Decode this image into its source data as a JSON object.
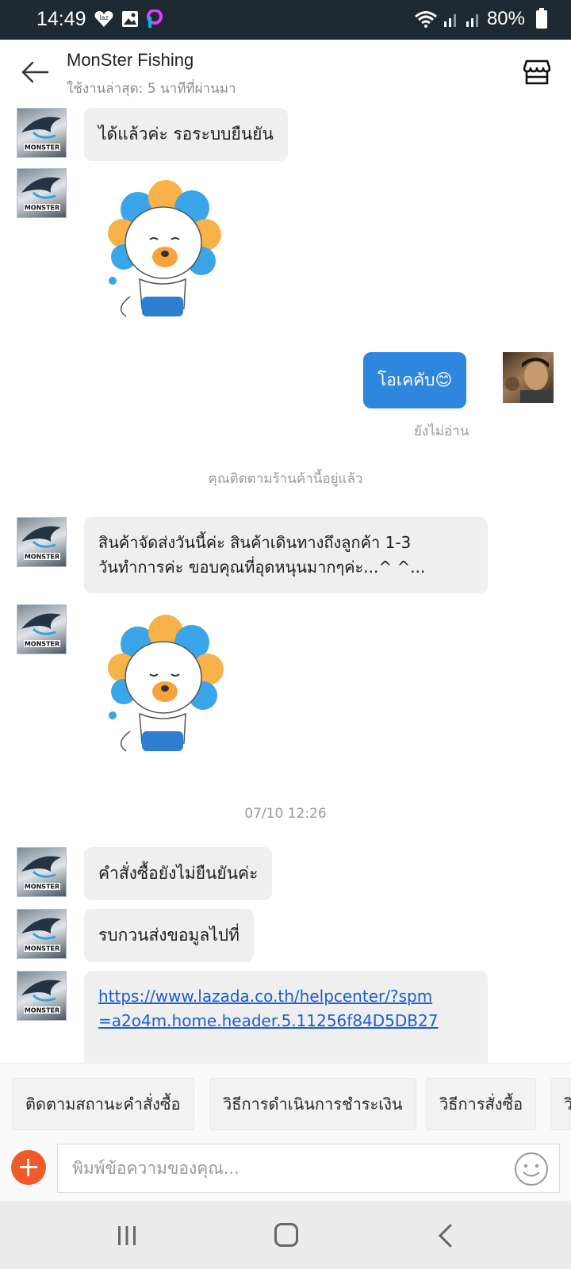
{
  "status_bar": {
    "time": "14:49",
    "battery": "80%"
  },
  "header": {
    "title": "MonSter Fishing",
    "subtitle": "ใช้งานล่าสุด: 5 นาทีที่ผ่านมา"
  },
  "messages": {
    "m1": "ได้แล้วค่ะ รอระบบยืนยัน",
    "out1": "โอเคคับ😊",
    "out1_status": "ยังไม่อ่าน",
    "system_follow": "คุณติดตามร้านค้านี้อยู่แล้ว",
    "m2_line1": "สินค้าจัดส่งวันนี้ค่ะ สินค้าเดินทางถึงลูกค้า 1-3",
    "m2_line2": "วันทำการค่ะ ขอบคุณที่อุดหนุนมากๆค่ะ...^ ^...",
    "timestamp": "07/10 12:26",
    "m3": "คำสั่งซื้อยังไม่ยืนยันค่ะ",
    "m4": "รบกวนส่งขอมูลไปที่",
    "m5_link_line1": "https://www.lazada.co.th/helpcenter/?spm",
    "m5_link_line2": "=a2o4m.home.header.5.11256f84D5DB27"
  },
  "quick_replies": [
    "ติดตามสถานะคำสั่งซื้อ",
    "วิธีการดำเนินการชำระเงิน",
    "วิธีการสั่งซื้อ",
    "วิ"
  ],
  "input": {
    "placeholder": "พิมพ์ข้อความของคุณ..."
  },
  "colors": {
    "accent_blue": "#2e86de",
    "plus_orange": "#f25a2a",
    "status_bar": "#1e2a33"
  }
}
